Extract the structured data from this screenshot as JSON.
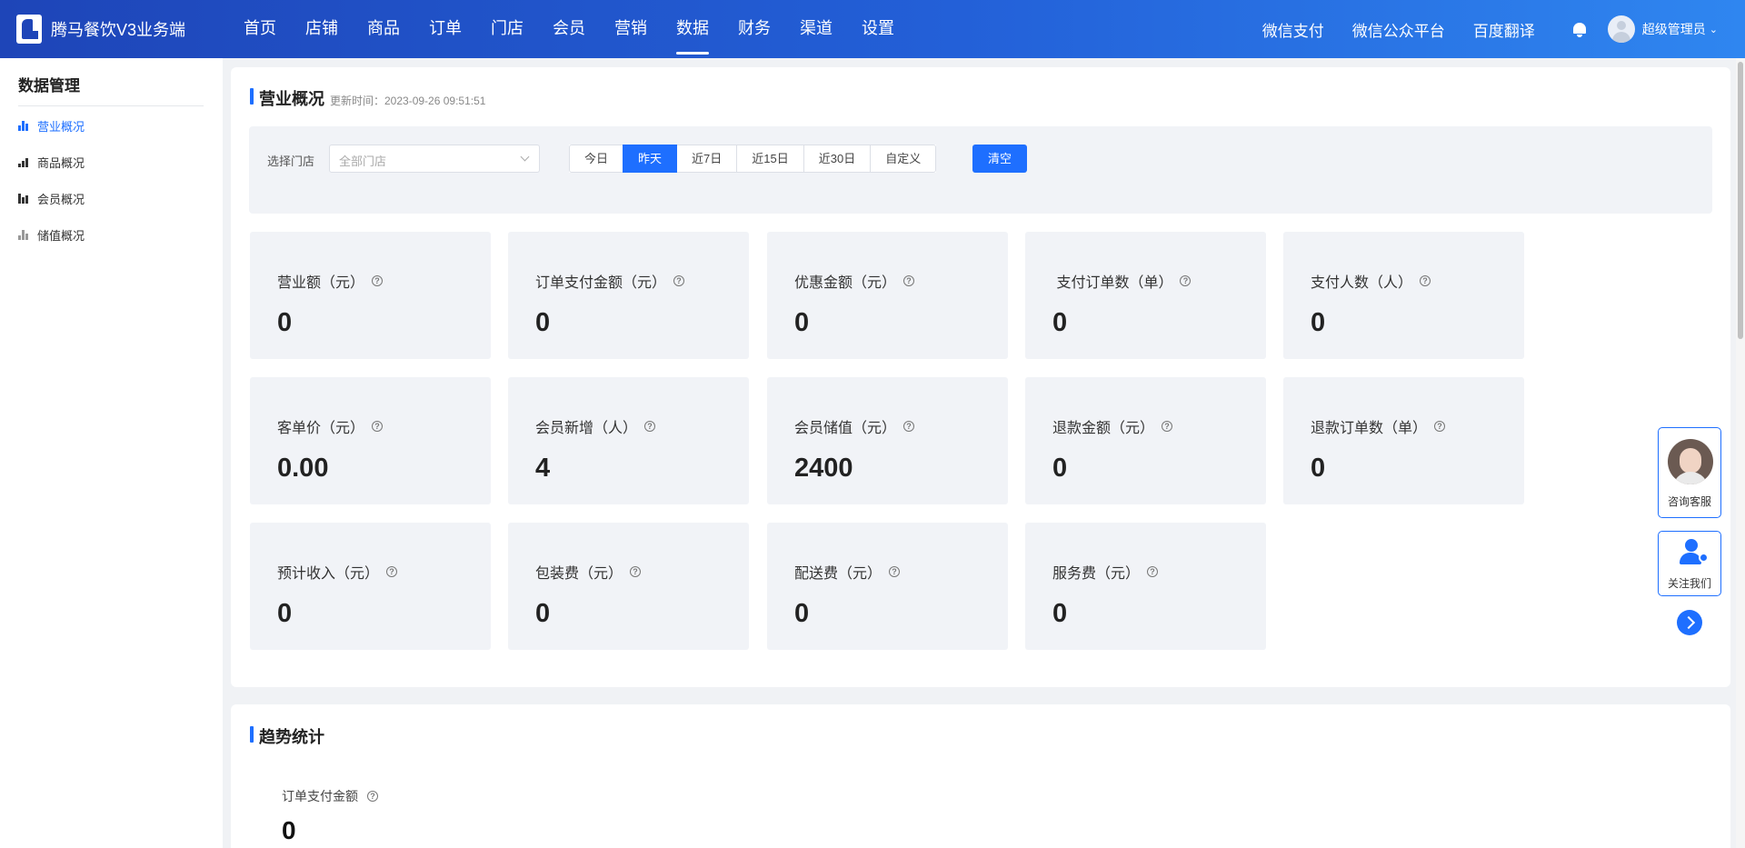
{
  "header": {
    "app_name": "腾马餐饮V3业务端",
    "nav": [
      "首页",
      "店铺",
      "商品",
      "订单",
      "门店",
      "会员",
      "营销",
      "数据",
      "财务",
      "渠道",
      "设置"
    ],
    "active_nav": "数据",
    "links": [
      "微信支付",
      "微信公众平台",
      "百度翻译"
    ],
    "user": "超级管理员"
  },
  "sidebar": {
    "title": "数据管理",
    "items": [
      {
        "label": "营业概况",
        "active": true
      },
      {
        "label": "商品概况",
        "active": false
      },
      {
        "label": "会员概况",
        "active": false
      },
      {
        "label": "储值概况",
        "active": false
      }
    ]
  },
  "overview": {
    "title": "营业概况",
    "update_time": "更新时间：2023-09-26 09:51:51",
    "filter": {
      "store_label": "选择门店",
      "store_placeholder": "全部门店",
      "ranges": [
        "今日",
        "昨天",
        "近7日",
        "近15日",
        "近30日",
        "自定义"
      ],
      "active_range": "昨天",
      "clear_label": "清空"
    },
    "stats": [
      {
        "label": "营业额（元）",
        "value": "0"
      },
      {
        "label": "订单支付金额（元）",
        "value": "0"
      },
      {
        "label": "优惠金额（元）",
        "value": "0"
      },
      {
        "label": " 支付订单数（单）",
        "value": "0"
      },
      {
        "label": "支付人数（人）",
        "value": "0"
      },
      {
        "label": "客单价（元）",
        "value": "0.00"
      },
      {
        "label": "会员新增（人）",
        "value": "4"
      },
      {
        "label": "会员储值（元）",
        "value": "2400"
      },
      {
        "label": "退款金额（元）",
        "value": "0"
      },
      {
        "label": "退款订单数（单）",
        "value": "0"
      },
      {
        "label": "预计收入（元）",
        "value": "0"
      },
      {
        "label": "包装费（元）",
        "value": "0"
      },
      {
        "label": "配送费（元）",
        "value": "0"
      },
      {
        "label": "服务费（元）",
        "value": "0"
      }
    ]
  },
  "trend": {
    "title": "趋势统计",
    "metric_label": "订单支付金额",
    "metric_value": "0"
  },
  "float": {
    "consult_label": "咨询客服",
    "follow_label": "关注我们"
  },
  "help_glyph": "?",
  "colors": {
    "primary": "#1e6fff",
    "header_start": "#1e45b8",
    "header_end": "#2f86f0"
  }
}
